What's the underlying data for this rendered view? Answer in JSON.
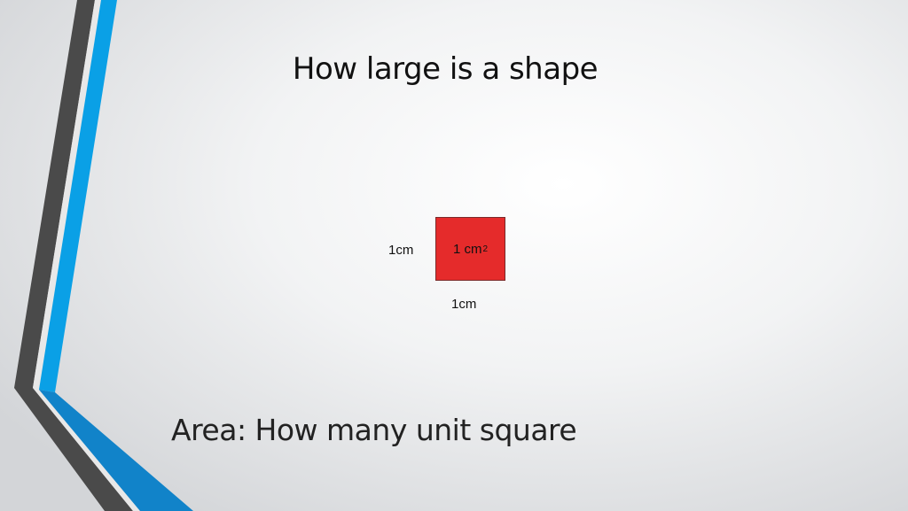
{
  "slide": {
    "title": "How large is a shape",
    "shape": {
      "area_value": "1 cm",
      "area_exponent": "2",
      "side_label_left": "1cm",
      "side_label_bottom": "1cm",
      "fill_color": "#e52b2b"
    },
    "subtitle": "Area: How many unit square",
    "accent_colors": {
      "dark_stripe": "#4a4a4a",
      "blue_stripe": "#0aa0e6"
    }
  }
}
